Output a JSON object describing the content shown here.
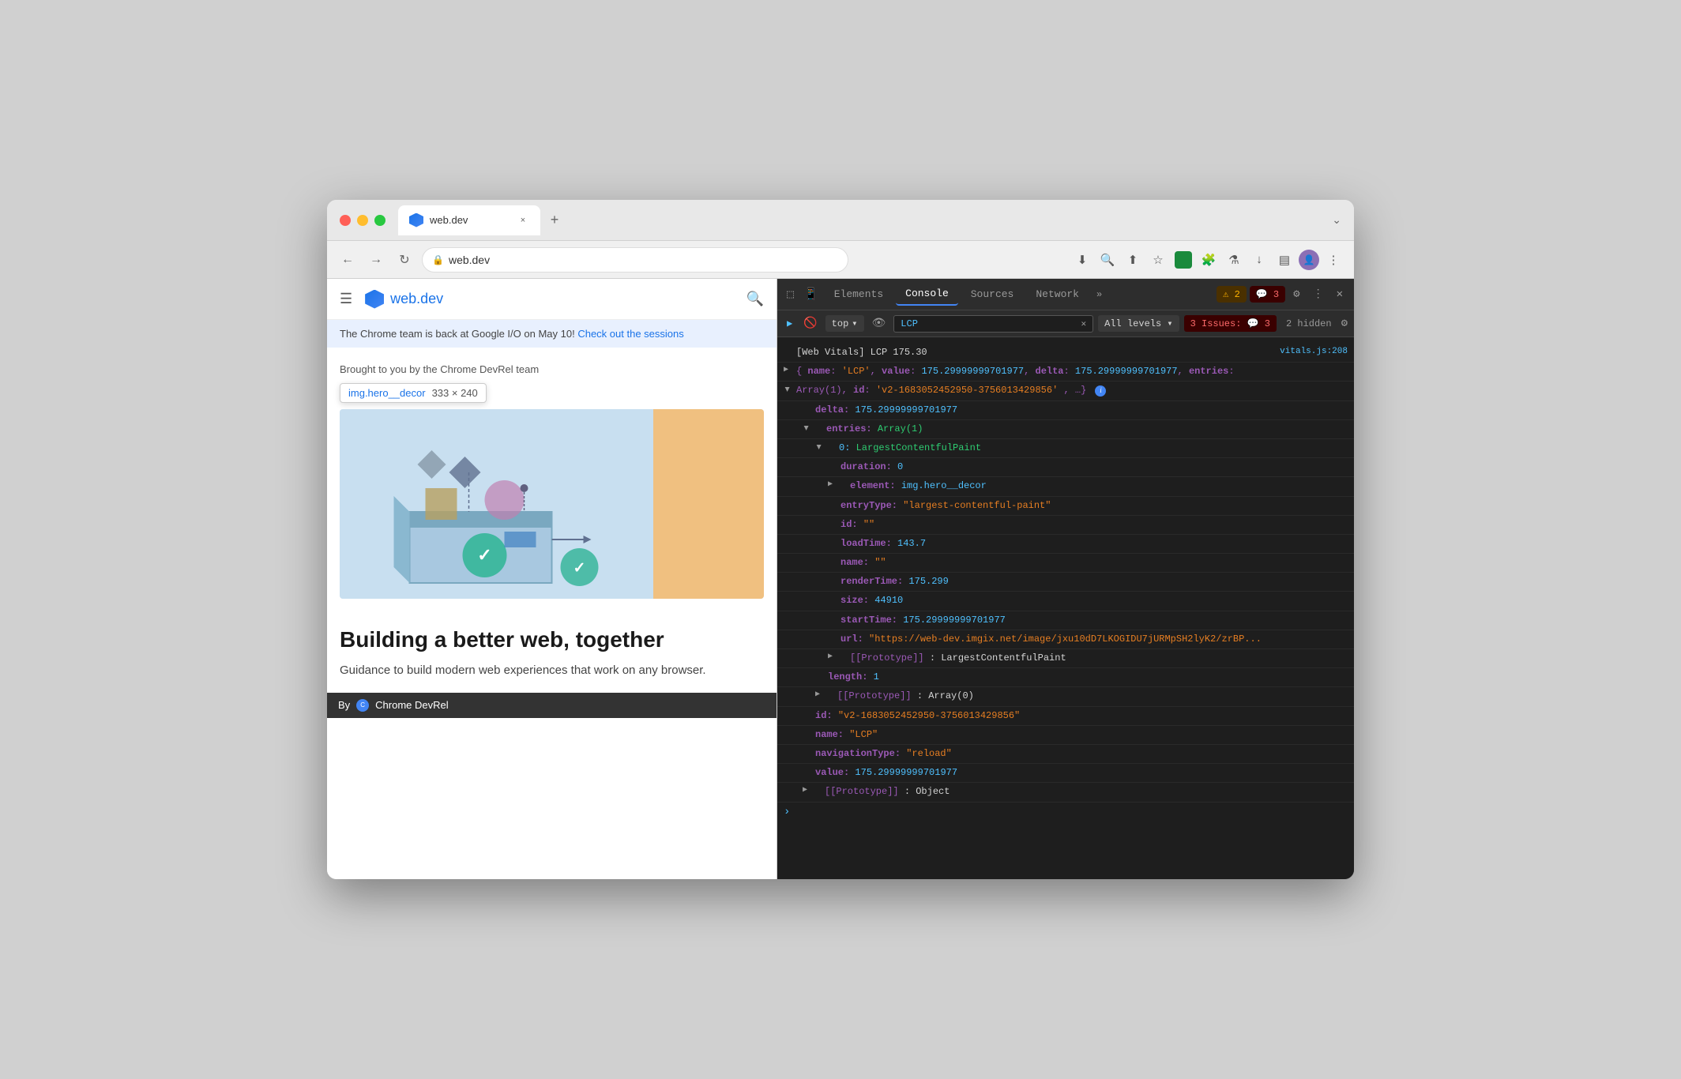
{
  "browser": {
    "tab": {
      "favicon": "web-dev-favicon",
      "title": "web.dev",
      "close_label": "×"
    },
    "new_tab_label": "+",
    "dropdown_label": "⌄",
    "nav": {
      "back_label": "←",
      "forward_label": "→",
      "reload_label": "↻",
      "address": "web.dev",
      "lock_icon": "🔒"
    },
    "toolbar": {
      "download_icon": "⬇",
      "zoom_icon": "🔍",
      "share_icon": "⬆",
      "bookmark_icon": "☆",
      "ext_green_icon": "■",
      "puzzle_icon": "🧩",
      "flask_icon": "⚗",
      "dl_icon": "↓",
      "sidebar_icon": "▤",
      "more_icon": "⋮"
    }
  },
  "webpage": {
    "nav": {
      "hamburger": "☰",
      "logo_text": "web.dev",
      "search_icon": "🔍"
    },
    "announcement": {
      "text": "The Chrome team is back at Google I/O on May 10!",
      "link_text": "Check out the sessions"
    },
    "hero": {
      "label": "Brought to you by the Chrome DevRel team",
      "element_tooltip": {
        "name": "img.hero__decor",
        "dims": "333 × 240"
      },
      "image_alt": "decorative hero illustration"
    },
    "content": {
      "title": "Building a better web, together",
      "description": "Guidance to build modern web experiences that work on any browser."
    },
    "footer": {
      "text": "By",
      "brand": "Chrome DevRel"
    }
  },
  "devtools": {
    "tabs": [
      "Elements",
      "Console",
      "Sources",
      "Network"
    ],
    "active_tab": "Console",
    "more_tabs_label": "»",
    "warning_count": "⚠ 2",
    "error_count": "💬 3",
    "settings_icon": "⚙",
    "more_icon": "⋮",
    "close_icon": "✕",
    "console_toolbar": {
      "execute_icon": "▶",
      "ban_icon": "🚫",
      "context": "top",
      "eye_icon": "👁",
      "filter_value": "LCP",
      "filter_clear": "✕",
      "levels": "All levels ▾",
      "issues_count": "3 Issues: 💬 3",
      "hidden_count": "2 hidden",
      "settings_icon": "⚙"
    },
    "console_output": [
      {
        "type": "log",
        "indent": 0,
        "expand": false,
        "source": "vitals.js:208",
        "content": "[Web Vitals] LCP 175.30"
      },
      {
        "type": "expand-open",
        "indent": 1,
        "arrow": "▶",
        "content": "{name: 'LCP', value: 175.29999999701977, delta: 175.29999999701977, entries:"
      },
      {
        "type": "expand-open",
        "indent": 1,
        "arrow": "▼",
        "content": "Array(1), id: 'v2-1683052452950-3756013429856', …}"
      },
      {
        "type": "prop",
        "indent": 2,
        "content_key": "delta:",
        "content_val": "175.29999999701977"
      },
      {
        "type": "expand-open",
        "indent": 2,
        "arrow": "▼",
        "content": "entries: Array(1)"
      },
      {
        "type": "expand-open",
        "indent": 3,
        "arrow": "▼",
        "content": "0: LargestContentfulPaint"
      },
      {
        "type": "prop",
        "indent": 4,
        "content_key": "duration:",
        "content_val": "0"
      },
      {
        "type": "expand-closed",
        "indent": 4,
        "arrow": "▶",
        "content": "element: img.hero__decor"
      },
      {
        "type": "prop",
        "indent": 4,
        "content_key": "entryType:",
        "content_val": "\"largest-contentful-paint\""
      },
      {
        "type": "prop",
        "indent": 4,
        "content_key": "id:",
        "content_val": "\"\""
      },
      {
        "type": "prop",
        "indent": 4,
        "content_key": "loadTime:",
        "content_val": "143.7"
      },
      {
        "type": "prop",
        "indent": 4,
        "content_key": "name:",
        "content_val": "\"\""
      },
      {
        "type": "prop",
        "indent": 4,
        "content_key": "renderTime:",
        "content_val": "175.299"
      },
      {
        "type": "prop",
        "indent": 4,
        "content_key": "size:",
        "content_val": "44910"
      },
      {
        "type": "prop",
        "indent": 4,
        "content_key": "startTime:",
        "content_val": "175.29999999701977"
      },
      {
        "type": "prop",
        "indent": 4,
        "content_key": "url:",
        "content_val": "\"https://web-dev.imgix.net/image/jxu10dD7LKOGIDU7jURMpSH2lyK2/zrBP..."
      },
      {
        "type": "expand-closed",
        "indent": 4,
        "arrow": "▶",
        "content": "[[Prototype]]: LargestContentfulPaint"
      },
      {
        "type": "prop",
        "indent": 3,
        "content_key": "length:",
        "content_val": "1"
      },
      {
        "type": "expand-closed",
        "indent": 3,
        "arrow": "▶",
        "content": "[[Prototype]]: Array(0)"
      },
      {
        "type": "prop",
        "indent": 2,
        "content_key": "id:",
        "content_val": "\"v2-1683052452950-3756013429856\""
      },
      {
        "type": "prop",
        "indent": 2,
        "content_key": "name:",
        "content_val": "\"LCP\""
      },
      {
        "type": "prop",
        "indent": 2,
        "content_key": "navigationType:",
        "content_val": "\"reload\""
      },
      {
        "type": "prop",
        "indent": 2,
        "content_key": "value:",
        "content_val": "175.29999999701977"
      },
      {
        "type": "expand-closed",
        "indent": 2,
        "arrow": "▶",
        "content": "[[Prototype]]: Object"
      }
    ]
  }
}
